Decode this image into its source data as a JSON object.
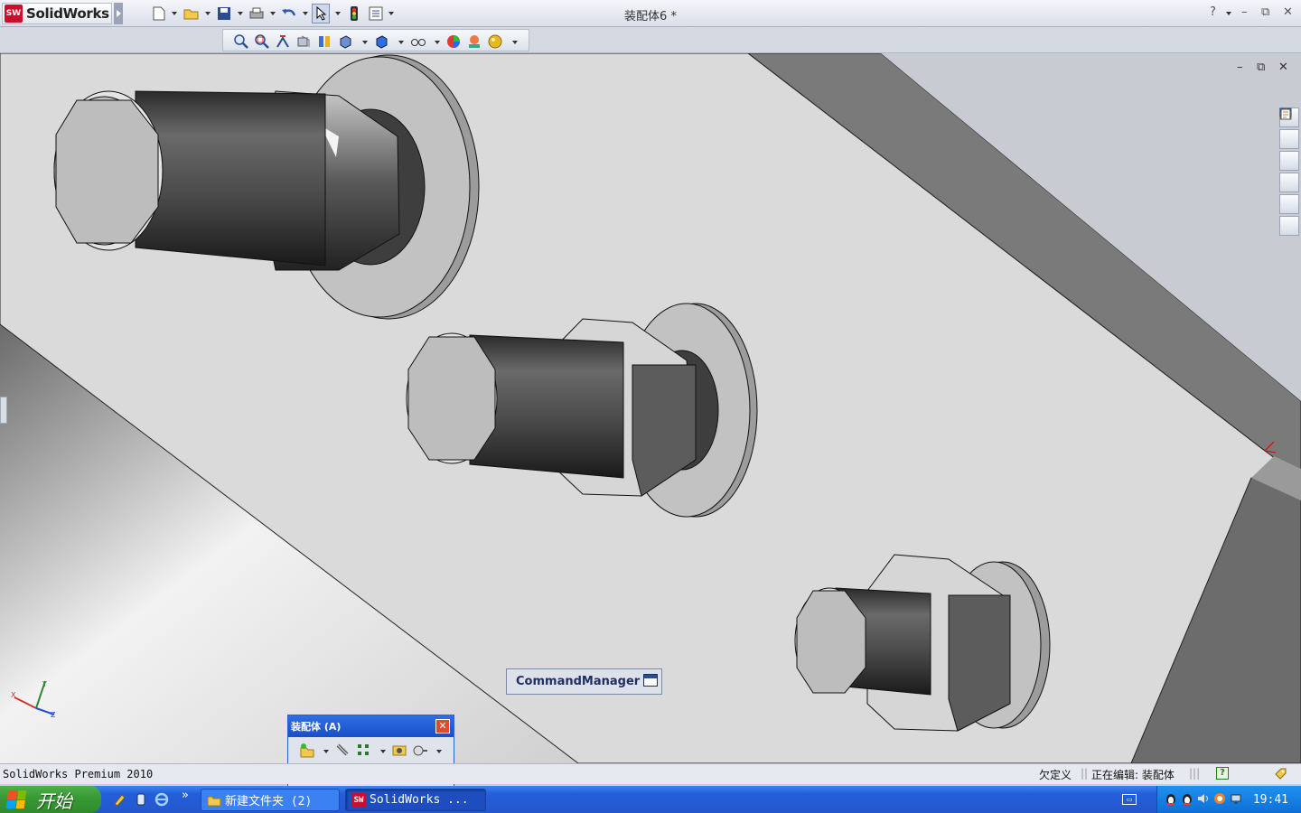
{
  "app": {
    "name": "SolidWorks",
    "logo_badge": "SW",
    "document_title": "装配体6 *"
  },
  "window_controls": {
    "help": "?",
    "minimize": "–",
    "restore": "⧉",
    "close": "✕"
  },
  "viewport": {
    "command_manager_label": "CommandManager"
  },
  "floating_toolbar": {
    "title": "装配体 (A)",
    "close": "✕"
  },
  "statusbar": {
    "product": "SolidWorks Premium 2010",
    "definition_state": "欠定义",
    "editing": "正在编辑: 装配体",
    "help_icon": "?"
  },
  "taskbar": {
    "start_label": "开始",
    "tasks": [
      {
        "label": "新建文件夹 (2)",
        "icon": "folder-icon"
      },
      {
        "label": "SolidWorks ...",
        "icon": "solidworks-icon"
      }
    ],
    "more_glyph": "»",
    "clock": "19:41"
  },
  "icons": {
    "toolbar": [
      "new-document-icon",
      "open-icon",
      "save-icon",
      "print-icon",
      "undo-icon",
      "select-icon",
      "rebuild-icon",
      "options-icon"
    ],
    "view": [
      "zoom-to-fit-icon",
      "zoom-to-area-icon",
      "previous-view-icon",
      "section-view-icon",
      "view-orientation-icon",
      "display-style-icon",
      "hide-show-icon",
      "edit-appearance-icon",
      "apply-scene-icon",
      "view-settings-icon"
    ],
    "task_pane": [
      "resources-icon",
      "design-library-icon",
      "file-explorer-icon",
      "view-palette-icon",
      "appearances-icon",
      "custom-properties-icon"
    ]
  },
  "colors": {
    "titlebar_accent": "#2a4d8f",
    "xp_taskbar": "#245edb",
    "xp_start": "#3a9a36",
    "floatbar_title": "#1a4fc6"
  }
}
